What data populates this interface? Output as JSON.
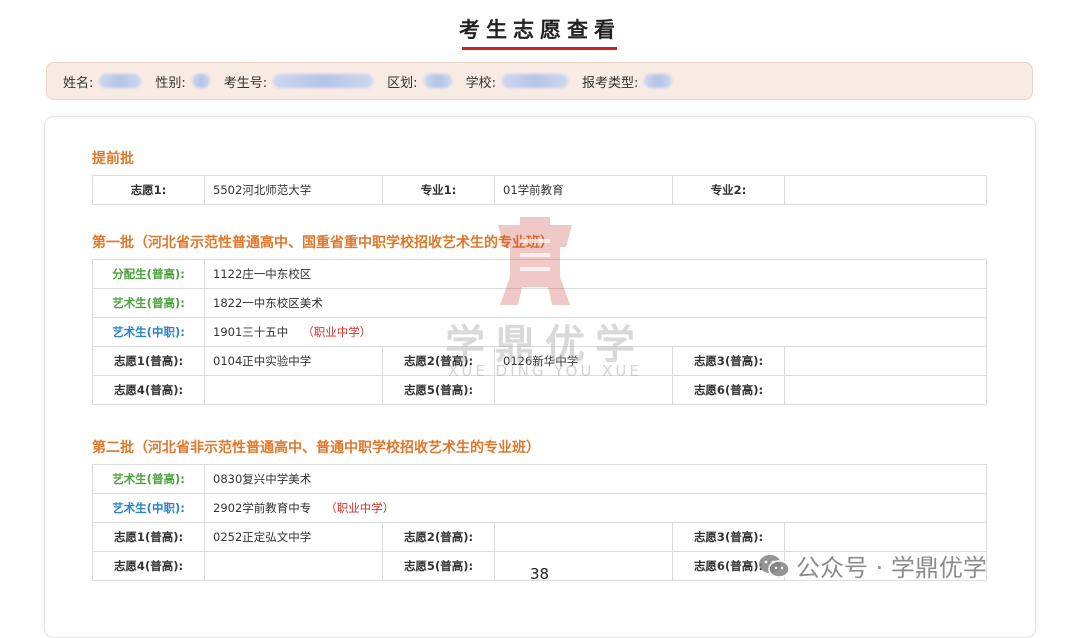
{
  "page": {
    "title": "考生志愿查看"
  },
  "info_bar": {
    "name_label": "姓名:",
    "gender_label": "性别:",
    "exam_no_label": "考生号:",
    "district_label": "区划:",
    "school_label": "学校:",
    "type_label": "报考类型:"
  },
  "advance": {
    "title": "提前批",
    "choice1_label": "志愿1:",
    "choice1_value": "5502河北师范大学",
    "major1_label": "专业1:",
    "major1_value": "01学前教育",
    "major2_label": "专业2:",
    "major2_value": ""
  },
  "batch1": {
    "title": "第一批（河北省示范性普通高中、国重省重中职学校招收艺术生的专业班）",
    "rows": [
      {
        "label": "分配生(普高):",
        "value": "1122庄一中东校区",
        "tag": ""
      },
      {
        "label": "艺术生(普高):",
        "value": "1822一中东校区美术",
        "tag": ""
      },
      {
        "label": "艺术生(中职):",
        "value": "1901三十五中",
        "tag": "（职业中学）"
      }
    ],
    "choices": [
      [
        {
          "label": "志愿1(普高):",
          "value": "0104正中实验中学"
        },
        {
          "label": "志愿2(普高):",
          "value": "0126新华中学"
        },
        {
          "label": "志愿3(普高):",
          "value": ""
        }
      ],
      [
        {
          "label": "志愿4(普高):",
          "value": ""
        },
        {
          "label": "志愿5(普高):",
          "value": ""
        },
        {
          "label": "志愿6(普高):",
          "value": ""
        }
      ]
    ]
  },
  "batch2": {
    "title": "第二批（河北省非示范性普通高中、普通中职学校招收艺术生的专业班）",
    "rows": [
      {
        "label": "艺术生(普高):",
        "value": "0830复兴中学美术",
        "tag": ""
      },
      {
        "label": "艺术生(中职):",
        "value": "2902学前教育中专",
        "tag": "（职业中学）"
      }
    ],
    "choices": [
      [
        {
          "label": "志愿1(普高):",
          "value": "0252正定弘文中学"
        },
        {
          "label": "志愿2(普高):",
          "value": ""
        },
        {
          "label": "志愿3(普高):",
          "value": ""
        }
      ],
      [
        {
          "label": "志愿4(普高):",
          "value": ""
        },
        {
          "label": "志愿5(普高):",
          "value": ""
        },
        {
          "label": "志愿6(普高):",
          "value": ""
        }
      ]
    ]
  },
  "watermark": {
    "text": "学鼎优学",
    "sub": "XUE DING YOU XUE"
  },
  "footer": {
    "page_number": "38",
    "wechat_label": "公众号 · 学鼎优学"
  },
  "colors": {
    "accent": "#c8261c",
    "section": "#e0782c",
    "green_label": "#4aa23a",
    "blue_label": "#2a83c9",
    "tag_red": "#d8302a"
  }
}
